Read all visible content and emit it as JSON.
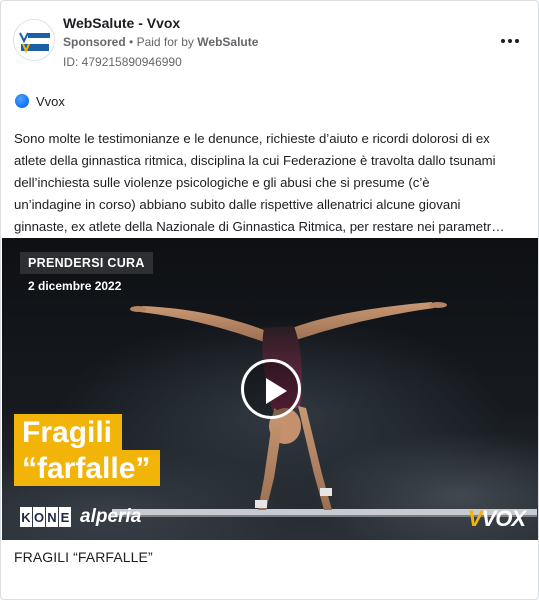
{
  "header": {
    "page_name": "WebSalute - Vvox",
    "sponsored": "Sponsored",
    "separator": "•",
    "paid_for_prefix": "Paid for by",
    "paid_for_by": "WebSalute",
    "ad_id": "ID: 479215890946990",
    "avatar_text_top": "SALUTE",
    "avatar_text_bottom": "VVOX"
  },
  "platform": {
    "label": "Vvox",
    "icon": "platform-dot-icon"
  },
  "ad_text": {
    "lines": [
      "Sono molte le testimonianze e le denunce, richieste d’aiuto e ricordi dolorosi di ex",
      "atlete della ginnastica ritmica, disciplina la cui Federazione è travolta dallo tsunami",
      "dell’inchiesta sulle violenze psicologiche e gli abusi che si presume (c’è",
      "un’indagine in corso) abbiano subito dalle rispettive allenatrici alcune giovani",
      "ginnaste, ex atlete della Nazionale di Ginnastica Ritmica, per restare nei parametr…"
    ]
  },
  "media": {
    "tag": "PRENDERSI CURA",
    "date": "2 dicembre 2022",
    "title_line_1": "Fragili",
    "title_line_2": "“farfalle”",
    "sponsor_1": "KONE",
    "sponsor_2": "alperia",
    "brand": "VVOX",
    "play_icon": "play-icon"
  },
  "caption": "FRAGILI “FARFALLE”",
  "colors": {
    "accent_yellow": "#f3b409",
    "platform_blue": "#1877f2",
    "text": "#1c1e21",
    "muted": "#65676b"
  }
}
